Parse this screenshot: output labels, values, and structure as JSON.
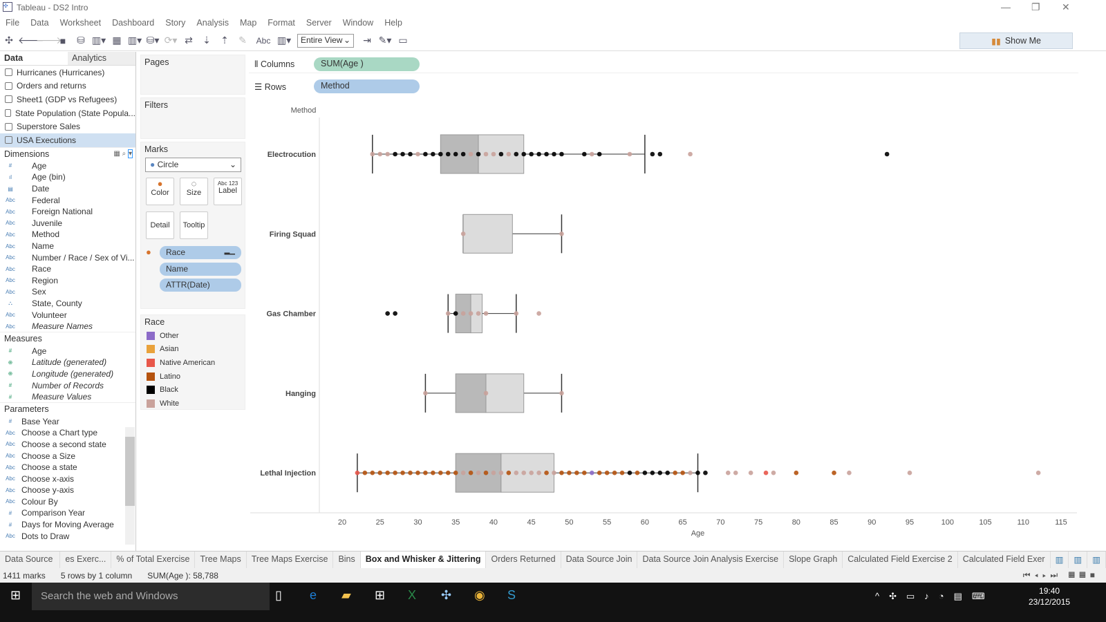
{
  "window": {
    "title": "Tableau - DS2 Intro"
  },
  "menu": [
    "File",
    "Data",
    "Worksheet",
    "Dashboard",
    "Story",
    "Analysis",
    "Map",
    "Format",
    "Server",
    "Window",
    "Help"
  ],
  "toolbar": {
    "view_select": "Entire View",
    "abc": "Abc",
    "show_me": "Show Me"
  },
  "left_panel": {
    "tabs": [
      "Data",
      "Analytics"
    ],
    "datasources": [
      "Hurricanes (Hurricanes)",
      "Orders and returns",
      "Sheet1 (GDP vs Refugees)",
      "State Population (State Popula...",
      "Superstore Sales",
      "USA Executions"
    ],
    "dimensions_title": "Dimensions",
    "dimensions": [
      {
        "t": "#",
        "n": "Age"
      },
      {
        "t": "ıl",
        "n": "Age (bin)"
      },
      {
        "t": "▤",
        "n": "Date"
      },
      {
        "t": "Abc",
        "n": "Federal"
      },
      {
        "t": "Abc",
        "n": "Foreign National"
      },
      {
        "t": "Abc",
        "n": "Juvenile"
      },
      {
        "t": "Abc",
        "n": "Method"
      },
      {
        "t": "Abc",
        "n": "Name"
      },
      {
        "t": "Abc",
        "n": "Number / Race / Sex of Vi..."
      },
      {
        "t": "Abc",
        "n": "Race"
      },
      {
        "t": "Abc",
        "n": "Region"
      },
      {
        "t": "Abc",
        "n": "Sex"
      },
      {
        "t": "⛬",
        "n": "State, County"
      },
      {
        "t": "Abc",
        "n": "Volunteer"
      },
      {
        "t": "Abc",
        "n": "Measure Names"
      }
    ],
    "measures_title": "Measures",
    "measures": [
      {
        "t": "#",
        "n": "Age"
      },
      {
        "t": "⊕",
        "n": "Latitude (generated)"
      },
      {
        "t": "⊕",
        "n": "Longitude (generated)"
      },
      {
        "t": "#",
        "n": "Number of Records"
      },
      {
        "t": "#",
        "n": "Measure Values"
      }
    ],
    "parameters_title": "Parameters",
    "parameters": [
      {
        "t": "#",
        "n": "Base Year"
      },
      {
        "t": "Abc",
        "n": "Choose a Chart type"
      },
      {
        "t": "Abc",
        "n": "Choose a second state"
      },
      {
        "t": "Abc",
        "n": "Choose a Size"
      },
      {
        "t": "Abc",
        "n": "Choose a state"
      },
      {
        "t": "Abc",
        "n": "Choose x-axis"
      },
      {
        "t": "Abc",
        "n": "Choose y-axis"
      },
      {
        "t": "Abc",
        "n": "Colour By"
      },
      {
        "t": "#",
        "n": "Comparison Year"
      },
      {
        "t": "#",
        "n": "Days for Moving Average"
      },
      {
        "t": "Abc",
        "n": "Dots to Draw"
      }
    ]
  },
  "cards": {
    "pages": "Pages",
    "filters": "Filters",
    "marks": "Marks",
    "mark_type": "Circle",
    "mark_buttons": [
      "Color",
      "Size",
      "Label",
      "Detail",
      "Tooltip"
    ],
    "label_icon": "Abc 123",
    "mark_pills": [
      "Race",
      "Name",
      "ATTR(Date)"
    ],
    "legend_title": "Race",
    "legend": [
      {
        "n": "Other",
        "c": "#8c6bc8"
      },
      {
        "n": "Asian",
        "c": "#e9a23b"
      },
      {
        "n": "Native American",
        "c": "#e8574a"
      },
      {
        "n": "Latino",
        "c": "#b5530f"
      },
      {
        "n": "Black",
        "c": "#000000"
      },
      {
        "n": "White",
        "c": "#c9a29b"
      }
    ]
  },
  "shelves": {
    "columns_label": "Columns",
    "columns_pill": "SUM(Age )",
    "rows_label": "Rows",
    "rows_pill": "Method"
  },
  "chart_data": {
    "type": "scatter",
    "header": "Method",
    "xlabel": "Age",
    "xlim": [
      17,
      117
    ],
    "xticks": [
      20,
      25,
      30,
      35,
      40,
      45,
      50,
      55,
      60,
      65,
      70,
      75,
      80,
      85,
      90,
      95,
      100,
      105,
      110,
      115
    ],
    "race_codes": {
      "O": "Other",
      "A": "Asian",
      "N": "Native American",
      "L": "Latino",
      "B": "Black",
      "W": "White"
    },
    "rows": [
      {
        "method": "Electrocution",
        "box": {
          "low": 24,
          "q1": 33,
          "median": 38,
          "q3": 44,
          "high": 60
        },
        "points": "24W 25W 26W 27B 28B 29B 30W 31B 32B 33B 34B 35B 36B 37W 38B 39W 40W 41B 42W 43B 44B 45B 46B 47B 48B 49B 52B 53W 54B 58W 61B 62B 66W 92B"
      },
      {
        "method": "Firing Squad",
        "box": {
          "low": 36,
          "q1": 36,
          "median": 36,
          "q3": 42.5,
          "high": 49
        },
        "points": "36W 49W"
      },
      {
        "method": "Gas Chamber",
        "box": {
          "low": 34,
          "q1": 35,
          "median": 37,
          "q3": 38.5,
          "high": 43
        },
        "points": "26B 27B 34W 35B 36W 37W 38W 39W 43W 46W"
      },
      {
        "method": "Hanging",
        "box": {
          "low": 31,
          "q1": 35,
          "median": 39,
          "q3": 44,
          "high": 49
        },
        "points": "31W 39W 49W"
      },
      {
        "method": "Lethal Injection",
        "box": {
          "low": 22,
          "q1": 35,
          "median": 41,
          "q3": 48,
          "high": 67
        },
        "points": "22N 23L 24L 25L 26L 27L 28L 29L 30L 31L 32L 33L 34L 35L 36W 37L 38W 39L 40W 41W 42L 43W 44W 45W 46W 47L 48W 49L 50L 51L 52L 53O 54L 55L 56L 57L 58B 59L 60B 61B 62B 63B 64L 65L 66W 67B 68B 71W 72W 74W 76N 77W 80L 85L 87W 95W 112W"
      }
    ]
  },
  "sheet_tabs": [
    "Data Source",
    "es Exerc...",
    "% of Total Exercise",
    "Tree Maps",
    "Tree Maps Exercise",
    "Bins",
    "Box and Whisker & Jittering",
    "Orders Returned",
    "Data Source Join",
    "Data Source Join Analysis Exercise",
    "Slope Graph",
    "Calculated Field Exercise 2",
    "Calculated Field Exer"
  ],
  "status": {
    "marks": "1411 marks",
    "dims": "5 rows by 1 column",
    "sum": "SUM(Age ): 58,788"
  },
  "taskbar": {
    "search": "Search the web and Windows",
    "time": "19:40",
    "date": "23/12/2015"
  }
}
